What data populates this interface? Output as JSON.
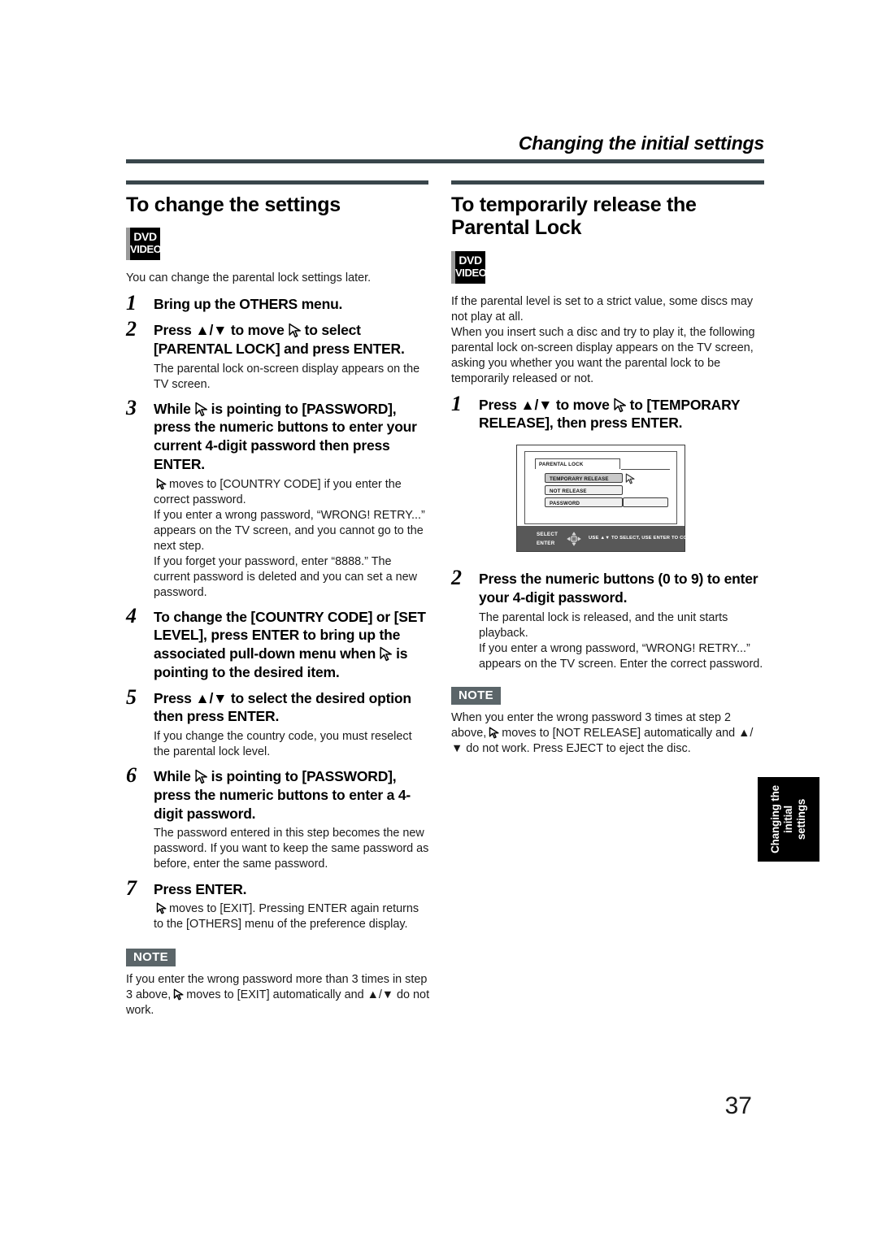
{
  "running_head": "Changing the initial settings",
  "page_number": "37",
  "colors": {
    "rule": "#39464b",
    "note_badge_bg": "#5b6569",
    "side_tab_bg": "#000000"
  },
  "disc_badge": {
    "line1": "DVD",
    "line2": "VIDEO"
  },
  "left_column": {
    "title": "To change the settings",
    "intro": "You can change the parental lock settings later.",
    "steps": [
      {
        "num": "1",
        "text": "Bring up the OTHERS menu."
      },
      {
        "num": "2",
        "text_a": "Press ▲/▼ to move",
        "text_b": "to select [PARENTAL LOCK] and press ENTER.",
        "sub": "The parental lock on-screen display appears on the TV screen."
      },
      {
        "num": "3",
        "text_a": "While",
        "text_b": "is pointing to [PASSWORD], press the numeric buttons to enter your current 4-digit password then press ENTER.",
        "sub_1_a": "moves to [COUNTRY CODE] if you enter the correct password.",
        "sub_2": "If you enter a wrong password, “WRONG! RETRY...” appears on the TV screen, and you cannot go to the next step.",
        "sub_3": "If you forget your password, enter “8888.” The current password is deleted and you can set a new password."
      },
      {
        "num": "4",
        "text_a": "To change the [COUNTRY CODE] or [SET LEVEL], press ENTER to bring up the associated pull-down menu when",
        "text_b": "is pointing to the desired item."
      },
      {
        "num": "5",
        "text": "Press ▲/▼ to select the desired option then press ENTER.",
        "sub": "If you change the country code, you must reselect the parental lock level."
      },
      {
        "num": "6",
        "text_a": "While",
        "text_b": "is pointing to [PASSWORD], press the numeric buttons to enter a 4-digit password.",
        "sub": "The password entered in this step becomes the new password. If you want to keep the same password as before, enter the same password."
      },
      {
        "num": "7",
        "text": "Press ENTER.",
        "sub_a": "moves to [EXIT]. Pressing ENTER again returns to the [OTHERS] menu of the preference display."
      }
    ],
    "note": {
      "label": "NOTE",
      "text_a": "If you enter the wrong password more than 3 times in step 3 above,",
      "text_b": "moves to [EXIT] automatically and ▲/▼ do not work."
    }
  },
  "right_column": {
    "title": "To temporarily release the Parental Lock",
    "intro": "If the parental level is set to a strict value, some discs may not play at all.\nWhen you insert such a disc and try to play it, the following parental lock on-screen display appears on the TV screen, asking you whether you want the parental lock to be temporarily released or not.",
    "steps": [
      {
        "num": "1",
        "text_a": "Press ▲/▼ to move",
        "text_b": "to [TEMPORARY RELEASE], then press ENTER."
      },
      {
        "num": "2",
        "text": "Press the numeric buttons (0 to 9) to enter your 4-digit password.",
        "sub_1": "The parental lock is released, and the unit starts playback.",
        "sub_2": "If you enter a wrong password, “WRONG! RETRY...” appears on the TV screen. Enter the correct password."
      }
    ],
    "note": {
      "label": "NOTE",
      "text_a": "When you enter the wrong password 3 times at step 2 above,",
      "text_b": "moves to [NOT RELEASE] automatically and ▲/▼ do not work. Press EJECT to eject the disc."
    }
  },
  "tv_figure": {
    "osd_tab": "PARENTAL LOCK",
    "rows": [
      {
        "label": "TEMPORARY RELEASE",
        "selected": true
      },
      {
        "label": "NOT RELEASE",
        "selected": false
      },
      {
        "label": "PASSWORD",
        "selected": false
      }
    ],
    "password_field_value": "",
    "bar_label_1": "SELECT",
    "bar_label_2": "ENTER",
    "bar_hint": "USE ▲▼ TO SELECT, USE ENTER TO CONFIRM"
  },
  "side_tab": {
    "line1": "Changing the",
    "line2": "initial",
    "line3": "settings"
  }
}
